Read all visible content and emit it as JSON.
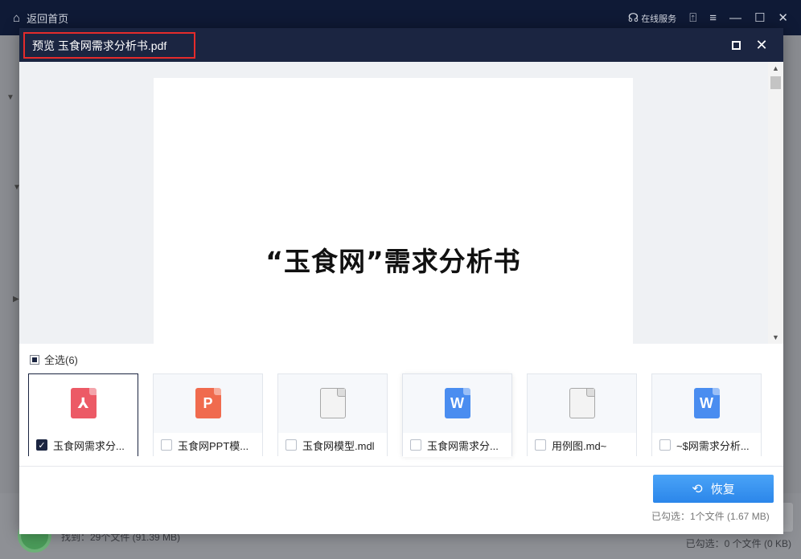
{
  "app": {
    "home_label": "返回首页",
    "online_service": "在线服务",
    "found_text": "找到：29个文件 (91.39 MB)",
    "selected_text": "已勾选：0 个文件 (0 KB)"
  },
  "dialog": {
    "title": "预览 玉食网需求分析书.pdf",
    "preview_heading": "“玉食网”需求分析书",
    "select_all_label": "全选(6)",
    "restore_label": "恢复",
    "restore_status": "已勾选：1个文件 (1.67 MB)"
  },
  "files": [
    {
      "name": "玉食网需求分...",
      "type": "pdf",
      "checked": true
    },
    {
      "name": "玉食网PPT模...",
      "type": "ppt",
      "checked": false
    },
    {
      "name": "玉食网模型.mdl",
      "type": "blank",
      "checked": false
    },
    {
      "name": "玉食网需求分...",
      "type": "doc",
      "checked": false
    },
    {
      "name": "用例图.md~",
      "type": "blank",
      "checked": false
    },
    {
      "name": "~$网需求分析...",
      "type": "doc",
      "checked": false
    }
  ],
  "colors": {
    "title_bar": "#1b2541",
    "highlight_border": "#e52b2b",
    "restore_button": "#2b86ea"
  }
}
